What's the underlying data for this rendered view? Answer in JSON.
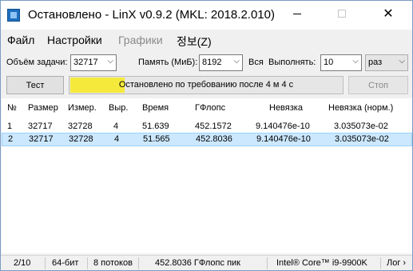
{
  "window": {
    "title": "Остановлено - LinX v0.9.2 (MKL: 2018.2.010)",
    "close_glyph": "✕"
  },
  "menu": {
    "file": "Файл",
    "settings": "Настройки",
    "graphs": "Графики",
    "about": "정보(Z)"
  },
  "params": {
    "task_label": "Объём задачи:",
    "task_value": "32717",
    "memory_label": "Память (МиБ):",
    "memory_value": "8192",
    "all_label": "Вся",
    "run_label": "Выполнять:",
    "run_value": "10",
    "unit_value": "раз"
  },
  "controls": {
    "test_button": "Тест",
    "status_text": "Остановлено по требованию после 4 м 4 с",
    "stop_button": "Стоп",
    "progress_fraction": 0.2
  },
  "table": {
    "headers": [
      "№",
      "Размер",
      "Измер.",
      "Выр.",
      "Время",
      "ГФлопс",
      "Невязка",
      "Невязка (норм.)"
    ],
    "rows": [
      [
        "1",
        "32717",
        "32728",
        "4",
        "51.639",
        "452.1572",
        "9.140476e-10",
        "3.035073e-02"
      ],
      [
        "2",
        "32717",
        "32728",
        "4",
        "51.565",
        "452.8036",
        "9.140476e-10",
        "3.035073e-02"
      ]
    ],
    "selected_row": 2
  },
  "status": {
    "progress": "2/10",
    "bits": "64-бит",
    "threads": "8 потоков",
    "peak": "452.8036 ГФлопс пик",
    "cpu": "Intel® Core™ i9-9900K",
    "log": "Лог ›"
  },
  "colors": {
    "progress_fill": "#f5ea3c",
    "selection": "#cce8ff"
  }
}
